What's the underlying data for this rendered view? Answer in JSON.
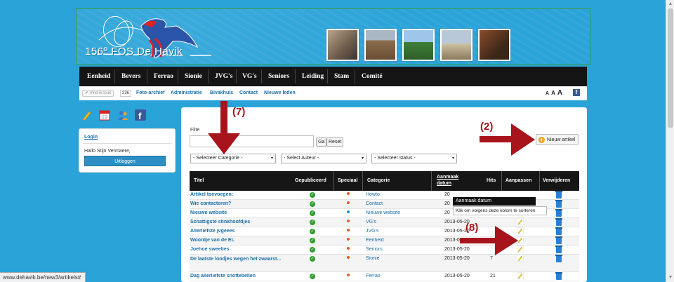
{
  "header": {
    "logo_text": "156º FOS De Havik",
    "photos": [
      "photo-1",
      "photo-2",
      "photo-3",
      "photo-4",
      "photo-5"
    ]
  },
  "nav": {
    "items": [
      "Eenheid",
      "Bevers",
      "Ferrao",
      "Sionie",
      "JVG's",
      "VG's",
      "Seniors",
      "Leiding",
      "Stam",
      "Comité"
    ]
  },
  "subnav": {
    "like_label": "Vind ik leuk",
    "like_count": "236",
    "links": [
      "Foto-archief",
      "Administratie",
      "Bivakhuis",
      "Contact",
      "Nieuwe leden"
    ],
    "font_sizes": [
      "A",
      "A",
      "A"
    ],
    "facebook": "f"
  },
  "sidebar": {
    "login_title": "Login",
    "hello": "Hallo Stijn Vermaere,",
    "logout": "Uitloggen"
  },
  "filters": {
    "label": "Filte",
    "search_value": "",
    "go_label": "Ga",
    "reset_label": "Reset",
    "category": "- Selecteer Categorie -",
    "author": "- Select Auteur -",
    "status": "- Selecteer status -"
  },
  "new_article_label": "Nieuw artikel",
  "table": {
    "headers": {
      "title": "Titel",
      "published": "Gepubliceerd",
      "special": "Speciaal",
      "category": "Categorie",
      "created": "Aanmaak datum",
      "hits": "Hits",
      "edit": "Aanpassen",
      "delete": "Verwijderen"
    },
    "rows": [
      {
        "title": "Artikel toevoegen:",
        "category": "Howto",
        "date": "20",
        "hits": "",
        "special": "orange"
      },
      {
        "title": "Wie contacteren?",
        "category": "Contact",
        "date": "20",
        "hits": "",
        "special": "orange"
      },
      {
        "title": "Nieuwe website",
        "category": "Nieuwe website",
        "date": "20",
        "hits": "",
        "special": "blue"
      },
      {
        "title": "Schattigste stinkhoofdjes",
        "category": "VG's",
        "date": "2013-05-20",
        "hits": "",
        "special": "orange"
      },
      {
        "title": "Allerliefste jvgeees",
        "category": "JVG's",
        "date": "2013-05-20",
        "hits": "",
        "special": "orange"
      },
      {
        "title": "Woordje van de EL",
        "category": "Eenheid",
        "date": "2013-05-20",
        "hits": "",
        "special": "orange"
      },
      {
        "title": "Joehoe sweeties",
        "category": "Seniors",
        "date": "2013-05-20",
        "hits": "",
        "special": "orange"
      },
      {
        "title": "De laatste loodjes wegen het zwaarst...",
        "category": "Sionie",
        "date": "2013-05-20",
        "hits": "7",
        "special": "orange"
      },
      {
        "title": "Dag allerliefste snottebellen",
        "category": "Ferrao",
        "date": "2013-05-20",
        "hits": "21",
        "special": "orange"
      }
    ]
  },
  "tooltip": {
    "title": "Aanmaak datum",
    "body": "Klik om volgens deze kolom te sorteren"
  },
  "annotations": [
    "(7)",
    "(2)",
    "(8)"
  ],
  "status_url": "www.dehavik.be/new3/artikels#",
  "colors": {
    "page_bg": "#2aa3d8",
    "nav_bg": "#151515",
    "link": "#1b6fa8",
    "annotation": "#a8141c",
    "published": "#2ba02b",
    "special": "#e65a1a"
  }
}
